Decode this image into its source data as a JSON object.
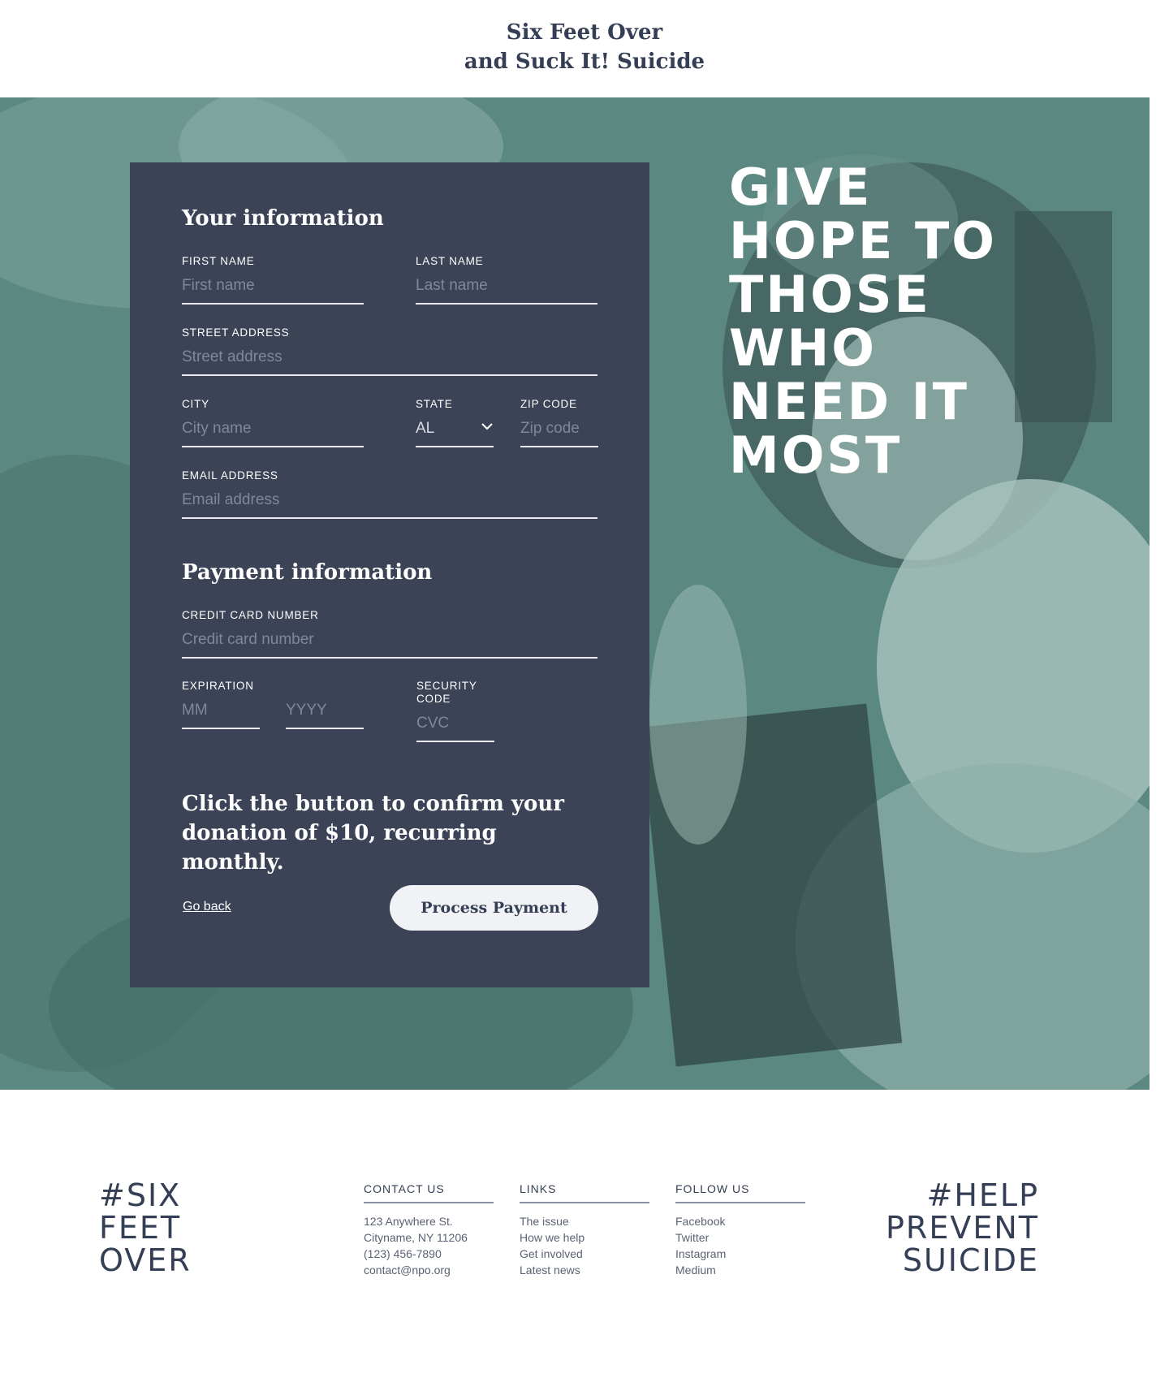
{
  "header": {
    "title_line1": "Six Feet Over",
    "title_line2": "and Suck It! Suicide"
  },
  "colors": {
    "card_bg": "#3c4356",
    "hero_tint": "#5a8680",
    "text_dark": "#343e54"
  },
  "form": {
    "your_info_title": "Your information",
    "first_name": {
      "label": "FIRST NAME",
      "placeholder": "First name"
    },
    "last_name": {
      "label": "LAST NAME",
      "placeholder": "Last name"
    },
    "street": {
      "label": "STREET ADDRESS",
      "placeholder": "Street address"
    },
    "city": {
      "label": "CITY",
      "placeholder": "City name"
    },
    "state": {
      "label": "STATE",
      "value": "AL"
    },
    "zip": {
      "label": "ZIP CODE",
      "placeholder": "Zip code"
    },
    "email": {
      "label": "EMAIL ADDRESS",
      "placeholder": "Email address"
    },
    "payment_title": "Payment information",
    "card_number": {
      "label": "CREDIT CARD NUMBER",
      "placeholder": "Credit card number"
    },
    "expiration": {
      "label": "EXPIRATION",
      "month_placeholder": "MM",
      "year_placeholder": "YYYY"
    },
    "security": {
      "label": "SECURITY CODE",
      "placeholder": "CVC"
    },
    "confirm_text": "Click the button to confirm your donation of $10, recurring monthly.",
    "go_back": "Go back",
    "submit": "Process Payment"
  },
  "tagline": {
    "line1": "GIVE",
    "line2": "HOPE TO",
    "line3": "THOSE",
    "line4": "WHO",
    "line5": "NEED IT",
    "line6": "MOST"
  },
  "footer": {
    "hash_left": {
      "line1": "#SIX",
      "line2": "FEET",
      "line3": "OVER"
    },
    "hash_right": {
      "line1": "#HELP",
      "line2": "PREVENT",
      "line3": "SUICIDE"
    },
    "contact": {
      "title": "CONTACT US",
      "items": [
        "123 Anywhere St.",
        "Cityname, NY 11206",
        "(123) 456-7890",
        "contact@npo.org"
      ]
    },
    "links": {
      "title": "LINKS",
      "items": [
        "The issue",
        "How we help",
        "Get involved",
        "Latest news"
      ]
    },
    "follow": {
      "title": "FOLLOW US",
      "items": [
        "Facebook",
        "Twitter",
        "Instagram",
        "Medium"
      ]
    }
  }
}
